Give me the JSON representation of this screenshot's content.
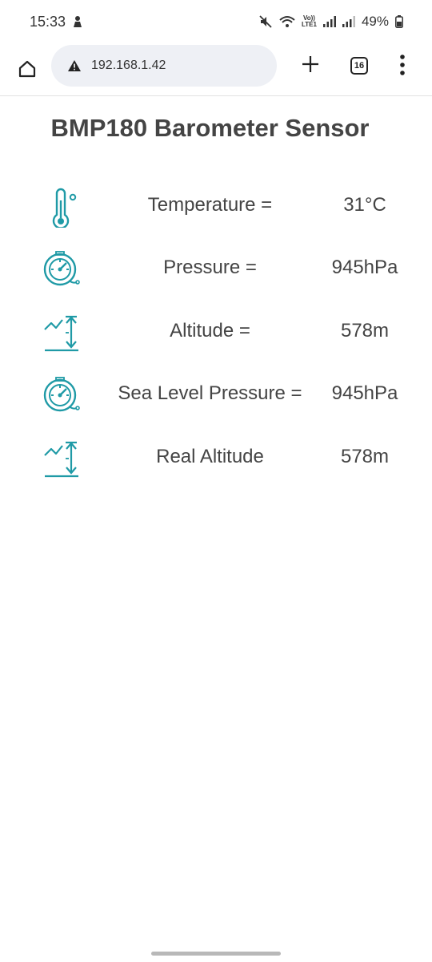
{
  "status_bar": {
    "time": "15:33",
    "battery": "49%",
    "volte_top": "Vo))",
    "volte_bottom": "LTE1"
  },
  "browser": {
    "url": "192.168.1.42",
    "tab_count": "16"
  },
  "page": {
    "title": "BMP180 Barometer Sensor",
    "readings": [
      {
        "icon": "thermometer-icon",
        "label": "Temperature =",
        "value": "31°C"
      },
      {
        "icon": "pressure-gauge-icon",
        "label": "Pressure =",
        "value": "945hPa"
      },
      {
        "icon": "altitude-icon",
        "label": "Altitude =",
        "value": "578m"
      },
      {
        "icon": "pressure-gauge-icon",
        "label": "Sea Level Pressure =",
        "value": "945hPa"
      },
      {
        "icon": "altitude-icon",
        "label": "Real Altitude",
        "value": "578m"
      }
    ]
  },
  "colors": {
    "icon_accent": "#1f9aa6",
    "text": "#444444"
  }
}
